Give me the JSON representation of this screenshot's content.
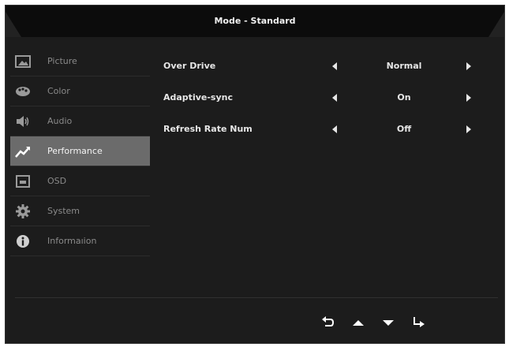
{
  "header": {
    "title": "Mode - Standard"
  },
  "sidebar": {
    "items": [
      {
        "label": "Picture",
        "icon": "picture-icon"
      },
      {
        "label": "Color",
        "icon": "color-icon"
      },
      {
        "label": "Audio",
        "icon": "audio-icon"
      },
      {
        "label": "Performance",
        "icon": "performance-icon",
        "active": true
      },
      {
        "label": "OSD",
        "icon": "osd-icon"
      },
      {
        "label": "System",
        "icon": "gear-icon"
      },
      {
        "label": "Informaıion",
        "icon": "info-icon"
      }
    ]
  },
  "settings": [
    {
      "name": "Over Drive",
      "value": "Normal"
    },
    {
      "name": "Adaptive-sync",
      "value": "On"
    },
    {
      "name": "Refresh Rate Num",
      "value": "Off"
    }
  ],
  "footer": {
    "buttons": [
      "back-icon",
      "up-icon",
      "down-icon",
      "enter-icon"
    ]
  },
  "colors": {
    "background": "#1c1c1c",
    "active_item": "#6b6b6b",
    "text": "#e6e6e6",
    "muted_text": "#8a8a8a"
  }
}
